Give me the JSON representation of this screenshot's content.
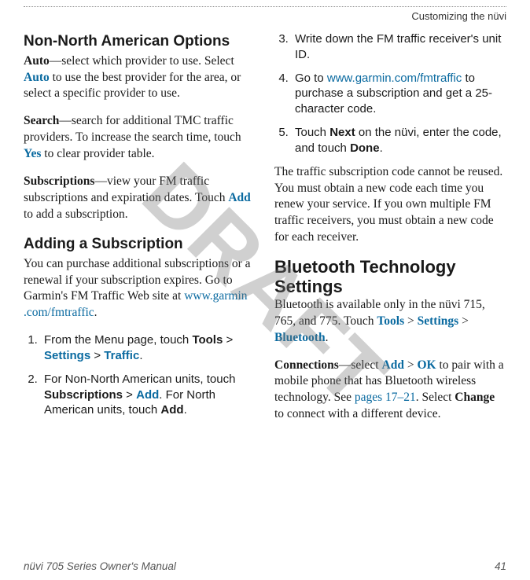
{
  "running_head": "Customizing the nüvi",
  "watermark": "DRAFT",
  "left": {
    "h1": "Non-North American Options",
    "auto": {
      "label": "Auto",
      "text1": "—select which provider to use. Select ",
      "autolink": "Auto",
      "text2": " to use the best provider for the area, or select a specific provider to use."
    },
    "search": {
      "label": "Search",
      "text1": "—search for additional TMC traffic providers. To increase the search time, touch ",
      "yes": "Yes",
      "text2": " to clear provider table."
    },
    "subs": {
      "label": "Subscriptions",
      "text1": "—view your FM traffic subscriptions and expiration dates. Touch ",
      "add": "Add",
      "text2": " to add a subscription."
    },
    "h2": "Adding a Subscription",
    "addsub_intro1": "You can purchase additional subscriptions or a renewal if your subscription expires. Go to Garmin's FM Traffic Web site at ",
    "addsub_link": "www.garmin\n.com/fmtraffic",
    "addsub_intro2": ".",
    "steps": {
      "s1a": "From the Menu page, touch ",
      "s1_tools": "Tools",
      "gt": " > ",
      "s1_settings": "Settings",
      "s1_traffic": "Traffic",
      "s1b": ".",
      "s2a": "For Non-North American units, touch ",
      "s2_subs": "Subscriptions",
      "s2_add": "Add",
      "s2b": ". For North American units, touch ",
      "s2_add2": "Add",
      "s2c": "."
    }
  },
  "right": {
    "steps": {
      "s3": "Write down the FM traffic receiver's unit ID.",
      "s4a": "Go to ",
      "s4_link": "www.garmin.com/fmtraffic",
      "s4b": " to purchase a subscription and get a 25-character code.",
      "s5a": "Touch ",
      "s5_next": "Next",
      "s5b": " on the nüvi, enter the code, and touch ",
      "s5_done": "Done",
      "s5c": "."
    },
    "note": "The traffic subscription code cannot be reused. You must obtain a new code each time you renew your service. If you own multiple FM traffic receivers, you must obtain a new code for each receiver.",
    "h1": "Bluetooth Technology Settings",
    "bt_intro1": "Bluetooth is available only in the nüvi 715, 765, and 775. Touch ",
    "bt_tools": "Tools",
    "gt": " > ",
    "bt_settings": "Settings",
    "bt_bluetooth": "Bluetooth",
    "bt_intro2": ".",
    "conn": {
      "label": "Connections",
      "t1": "—select ",
      "add": "Add",
      "t2": " > ",
      "ok": "OK",
      "t3": " to pair with a mobile phone that has Bluetooth wireless technology. See ",
      "pages": "pages 17–21",
      "t4": ". Select ",
      "change": "Change",
      "t5": " to connect with a different device."
    }
  },
  "footer": {
    "left": "nüvi 705 Series Owner's Manual",
    "right": "41"
  }
}
